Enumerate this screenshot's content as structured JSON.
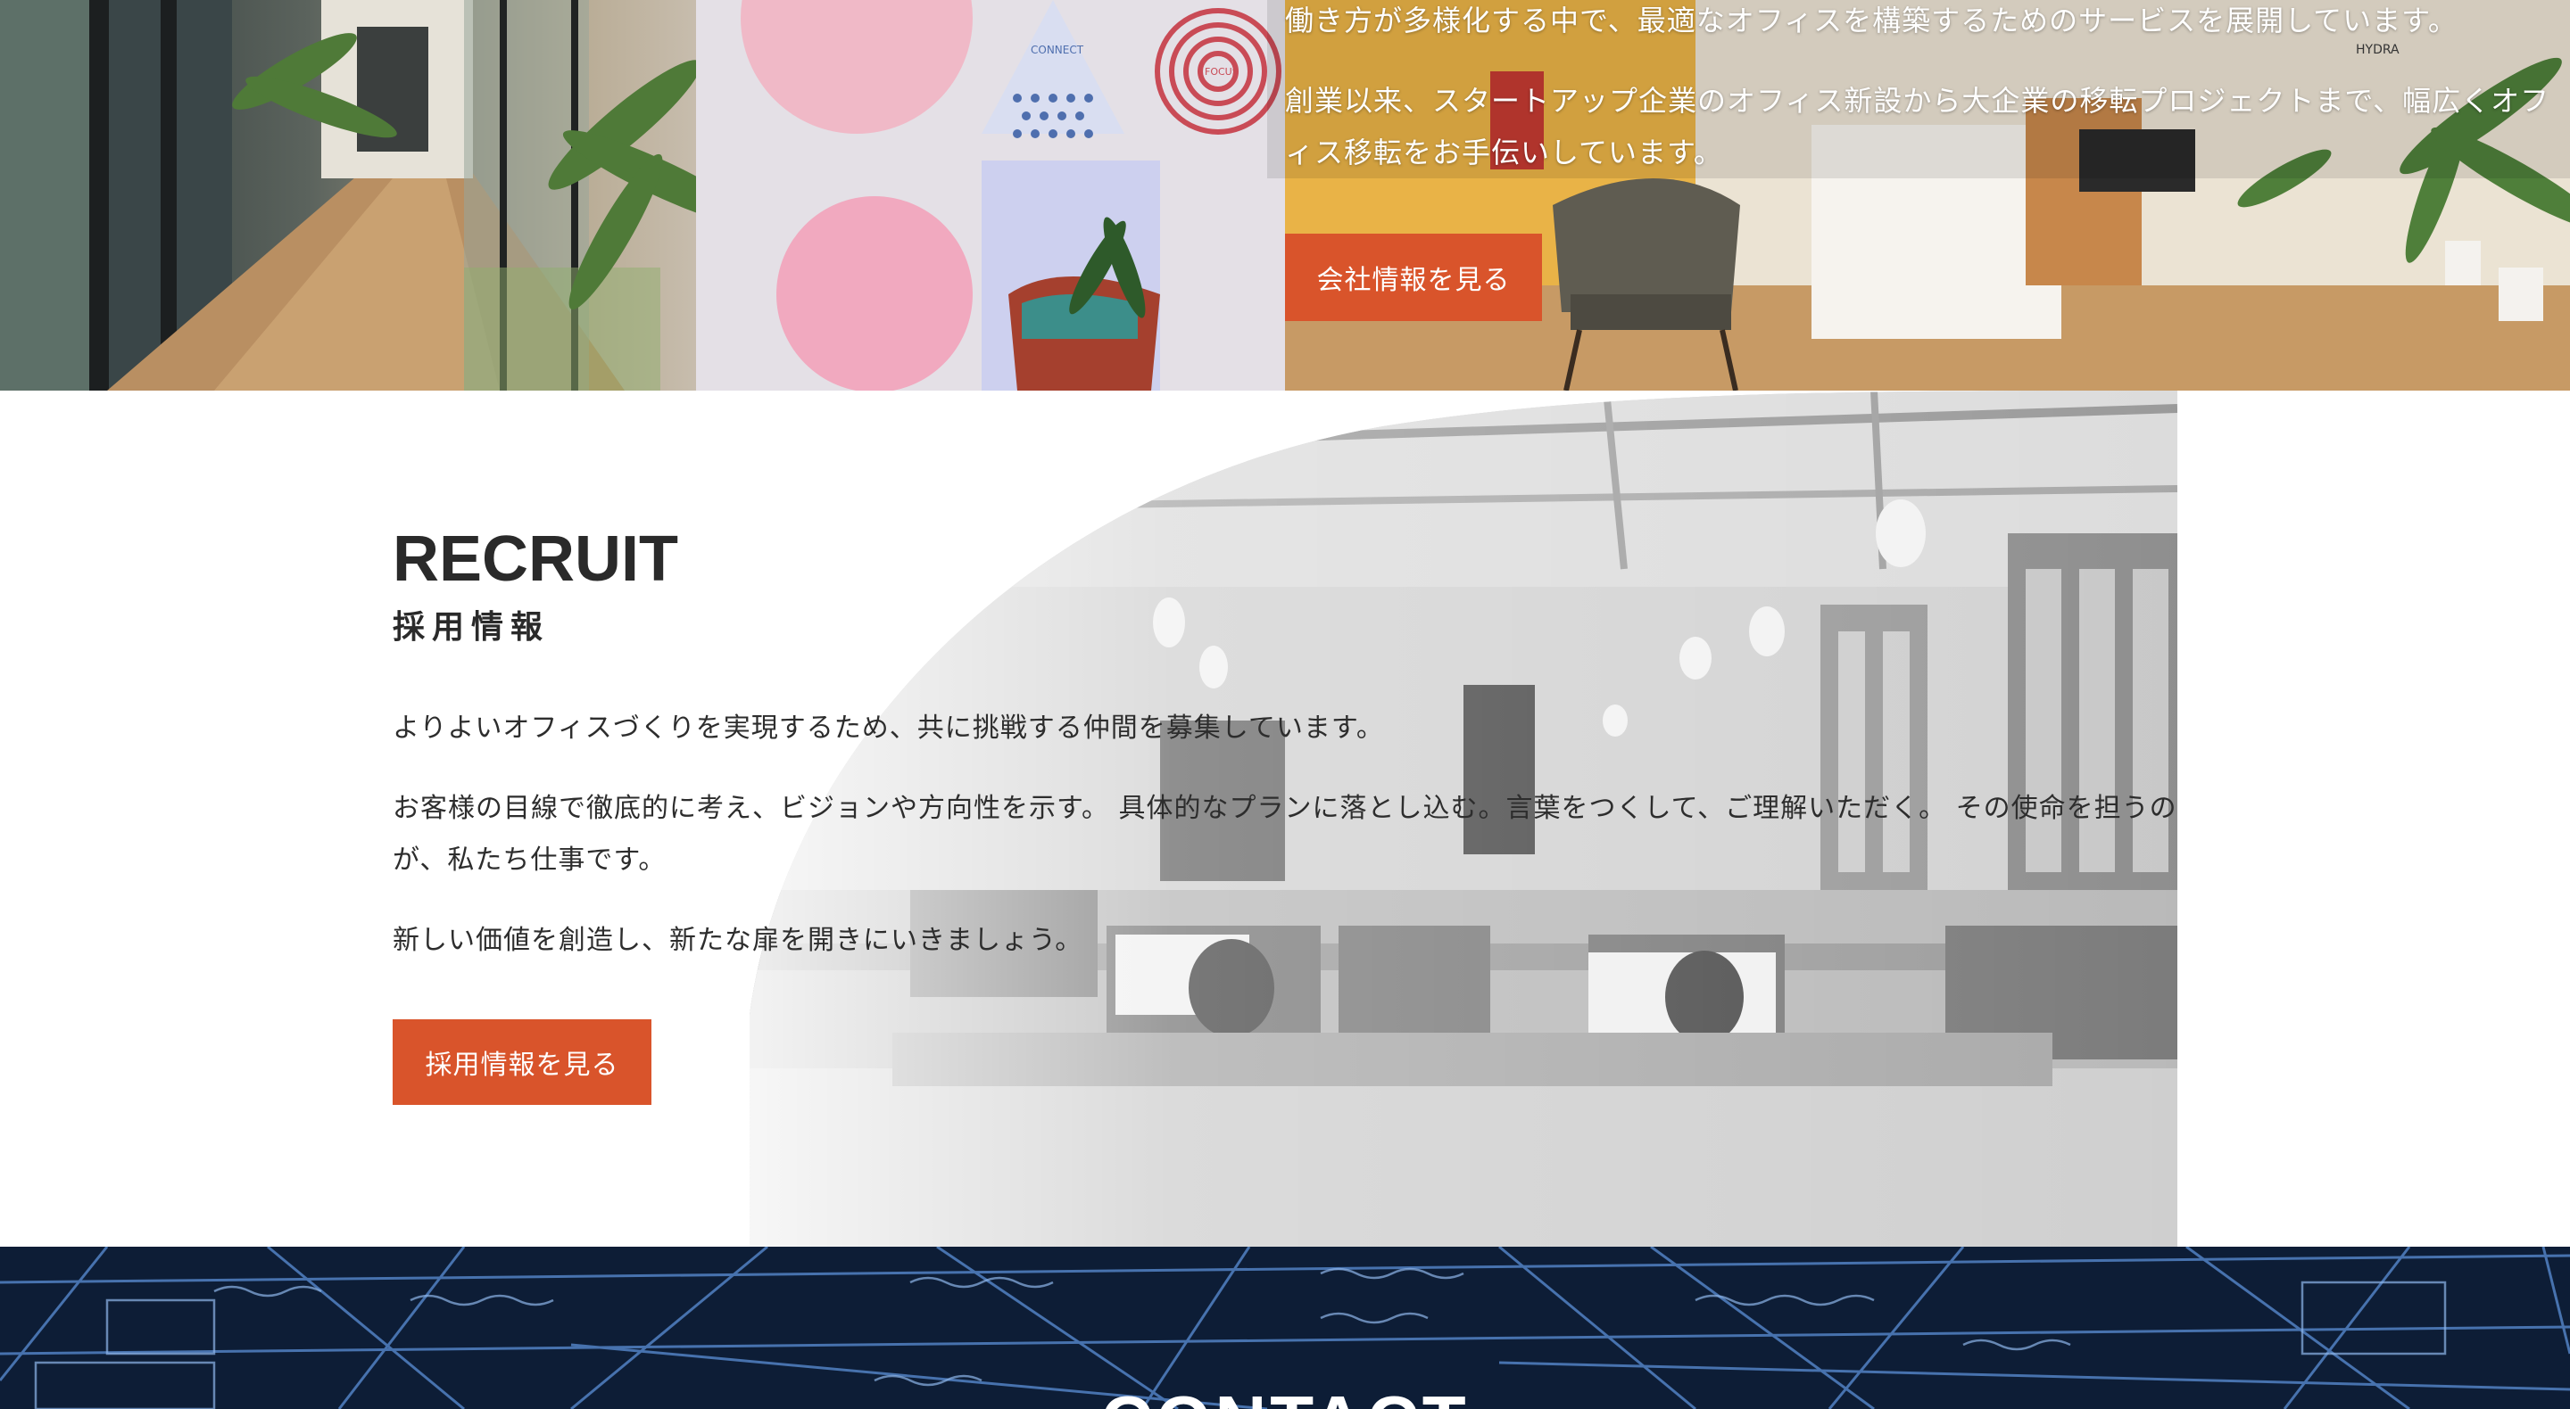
{
  "company": {
    "paragraph_1": "働き方が多様化する中で、最適なオフィスを構築するためのサービスを展開しています。",
    "paragraph_2": "創業以来、スタートアップ企業のオフィス新設から大企業の移転プロジェクトまで、幅広くオフィス移転をお手伝いしています。",
    "button_label": "会社情報を見る",
    "photo_signs": [
      "CONNECT",
      "FOCUS",
      "HYDRA"
    ]
  },
  "recruit": {
    "title": "RECRUIT",
    "subtitle": "採用情報",
    "paragraphs": [
      "よりよいオフィスづくりを実現するため、共に挑戦する仲間を募集しています。",
      "お客様の目線で徹底的に考え、ビジョンや方向性を示す。 具体的なプランに落とし込む。言葉をつくして、ご理解いただく。 その使命を担うのが、私たち仕事です。",
      "新しい価値を創造し、新たな扉を開きにいきましょう。"
    ],
    "button_label": "採用情報を見る"
  },
  "contact": {
    "title": "CONTACT"
  },
  "colors": {
    "accent": "#d9542b",
    "text_dark": "#2a2a2a",
    "contact_bg": "#0d1d36"
  }
}
